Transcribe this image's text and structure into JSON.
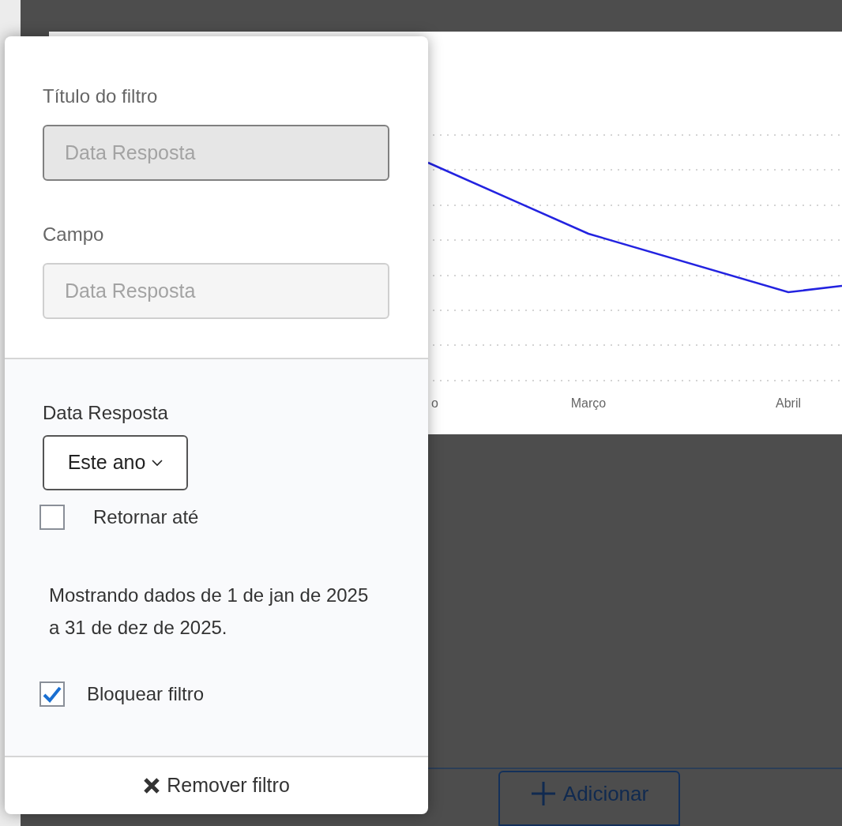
{
  "chart": {
    "x_labels": [
      "o",
      "Março",
      "Abril"
    ]
  },
  "add_button": {
    "label": "Adicionar"
  },
  "filter_popover": {
    "fields": [
      {
        "label": "Título do filtro",
        "placeholder": "Data Resposta",
        "kind": "locked"
      },
      {
        "label": "Campo",
        "placeholder": "Data Resposta",
        "kind": "disabled"
      }
    ],
    "date_label": "Data Resposta",
    "range_dropdown": {
      "value": "Este ano"
    },
    "return_until": {
      "label": "Retornar até",
      "checked": false
    },
    "summary": "Mostrando dados de 1 de jan de 2025 a 31 de dez de 2025.",
    "lock_filter": {
      "label": "Bloquear filtro",
      "checked": true
    },
    "remove_button": {
      "label": "Remover filtro"
    }
  }
}
